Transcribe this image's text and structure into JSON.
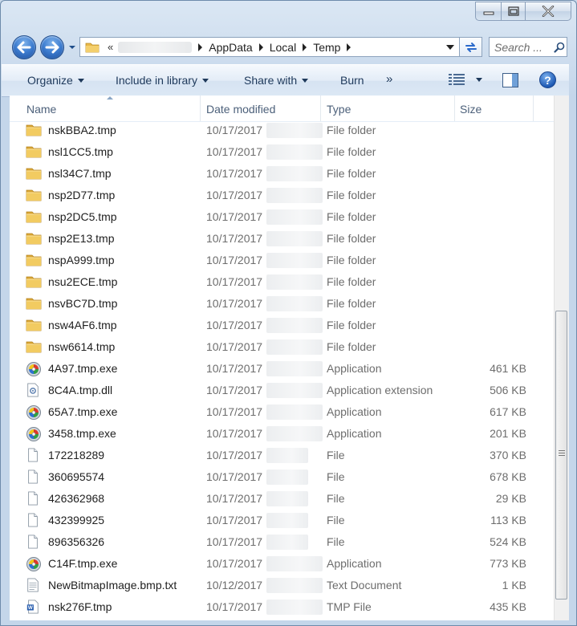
{
  "window": {
    "minimize_label": "Minimize",
    "maximize_label": "Maximize",
    "close_label": "Close"
  },
  "address": {
    "overflow_chevron": "«",
    "crumbs": [
      "AppData",
      "Local",
      "Temp"
    ]
  },
  "search": {
    "placeholder": "Search ..."
  },
  "toolbar": {
    "organize": "Organize",
    "include_in_library": "Include in library",
    "share_with": "Share with",
    "burn": "Burn",
    "more": "»",
    "help": "?"
  },
  "columns": {
    "name": "Name",
    "date_modified": "Date modified",
    "type": "Type",
    "size": "Size"
  },
  "files": [
    {
      "name": "nskBBA2.tmp",
      "date": "10/17/2017",
      "type": "File folder",
      "size": "",
      "icon": "folder-icon"
    },
    {
      "name": "nsl1CC5.tmp",
      "date": "10/17/2017",
      "type": "File folder",
      "size": "",
      "icon": "folder-icon"
    },
    {
      "name": "nsl34C7.tmp",
      "date": "10/17/2017",
      "type": "File folder",
      "size": "",
      "icon": "folder-icon"
    },
    {
      "name": "nsp2D77.tmp",
      "date": "10/17/2017",
      "type": "File folder",
      "size": "",
      "icon": "folder-icon"
    },
    {
      "name": "nsp2DC5.tmp",
      "date": "10/17/2017",
      "type": "File folder",
      "size": "",
      "icon": "folder-icon"
    },
    {
      "name": "nsp2E13.tmp",
      "date": "10/17/2017",
      "type": "File folder",
      "size": "",
      "icon": "folder-icon"
    },
    {
      "name": "nspA999.tmp",
      "date": "10/17/2017",
      "type": "File folder",
      "size": "",
      "icon": "folder-icon"
    },
    {
      "name": "nsu2ECE.tmp",
      "date": "10/17/2017",
      "type": "File folder",
      "size": "",
      "icon": "folder-icon"
    },
    {
      "name": "nsvBC7D.tmp",
      "date": "10/17/2017",
      "type": "File folder",
      "size": "",
      "icon": "folder-icon"
    },
    {
      "name": "nsw4AF6.tmp",
      "date": "10/17/2017",
      "type": "File folder",
      "size": "",
      "icon": "folder-icon"
    },
    {
      "name": "nsw6614.tmp",
      "date": "10/17/2017",
      "type": "File folder",
      "size": "",
      "icon": "folder-icon"
    },
    {
      "name": "4A97.tmp.exe",
      "date": "10/17/2017",
      "type": "Application",
      "size": "461 KB",
      "icon": "installer-icon"
    },
    {
      "name": "8C4A.tmp.dll",
      "date": "10/17/2017",
      "type": "Application extension",
      "size": "506 KB",
      "icon": "dll-icon"
    },
    {
      "name": "65A7.tmp.exe",
      "date": "10/17/2017",
      "type": "Application",
      "size": "617 KB",
      "icon": "installer-icon"
    },
    {
      "name": "3458.tmp.exe",
      "date": "10/17/2017",
      "type": "Application",
      "size": "201 KB",
      "icon": "installer-icon"
    },
    {
      "name": "172218289",
      "date": "10/17/2017",
      "type": "File",
      "size": "370 KB",
      "icon": "blank-file-icon"
    },
    {
      "name": "360695574",
      "date": "10/17/2017",
      "type": "File",
      "size": "678 KB",
      "icon": "blank-file-icon"
    },
    {
      "name": "426362968",
      "date": "10/17/2017",
      "type": "File",
      "size": "29 KB",
      "icon": "blank-file-icon"
    },
    {
      "name": "432399925",
      "date": "10/17/2017",
      "type": "File",
      "size": "113 KB",
      "icon": "blank-file-icon"
    },
    {
      "name": "896356326",
      "date": "10/17/2017",
      "type": "File",
      "size": "524 KB",
      "icon": "blank-file-icon"
    },
    {
      "name": "C14F.tmp.exe",
      "date": "10/17/2017",
      "type": "Application",
      "size": "773 KB",
      "icon": "installer-icon"
    },
    {
      "name": "NewBitmapImage.bmp.txt",
      "date": "10/12/2017",
      "type": "Text Document",
      "size": "1 KB",
      "icon": "text-file-icon"
    },
    {
      "name": "nsk276F.tmp",
      "date": "10/17/2017",
      "type": "TMP File",
      "size": "435 KB",
      "icon": "word-file-icon"
    }
  ],
  "colors": {
    "folder": "#e8b84a",
    "accent": "#1e395b",
    "secondary_text": "#6d6d6d"
  }
}
